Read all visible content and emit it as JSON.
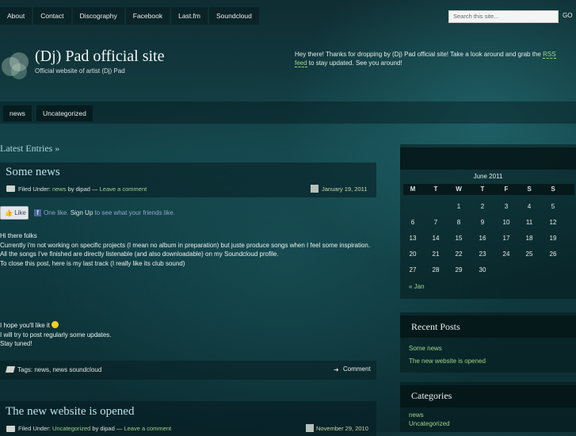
{
  "nav": [
    "About",
    "Contact",
    "Discography",
    "Facebook",
    "Last.fm",
    "Soundcloud"
  ],
  "search": {
    "placeholder": "Search this site...",
    "go_label": "GO"
  },
  "site": {
    "title": "(Dj) Pad official site",
    "tagline": "Official website of artist (Dj) Pad",
    "welcome_before": "Hey there! Thanks for dropping by (Dj) Pad official site! Take a look around and grab the ",
    "welcome_link": "RSS feed",
    "welcome_after": " to stay updated. See you around!"
  },
  "categories_bar": [
    "news",
    "Uncategorized"
  ],
  "latest_label": "Latest Entries »",
  "posts": [
    {
      "title": "Some news",
      "filed_under": "Filed Under:",
      "category": "news",
      "by": "by dipad —",
      "comment_link": "Leave a comment",
      "date": "January 19, 2011"
    },
    {
      "title": "The new website is opened",
      "filed_under": "Filed Under:",
      "category": "Uncategorized",
      "by": "by dipad —",
      "comment_link": "Leave a comment",
      "date": "November 29, 2010"
    }
  ],
  "like": {
    "button": "Like",
    "count": "One like.",
    "signup": "Sign Up",
    "rest": "to see what your friends like."
  },
  "post_body": [
    "Hi there folks",
    "Currently i'm not working on specific projects (I mean no album in preparation) but juste produce songs when  I feel some inspiration.",
    "All the songs I've finished are directly listenable (and also downloadable) on my Soundcloud profile.",
    "To close this post, here is my last track (I really like its club sound)"
  ],
  "post_end": [
    "I hope you'll like it",
    "I will try to post regularly some updates.",
    "Stay tuned!"
  ],
  "post_footer": {
    "tags_label": "Tags:",
    "tags": "news, news soundcloud",
    "comment": "Comment"
  },
  "calendar": {
    "caption": "June 2011",
    "days": [
      "M",
      "T",
      "W",
      "T",
      "F",
      "S",
      "S"
    ],
    "weeks": [
      [
        "",
        "",
        "1",
        "2",
        "3",
        "4",
        "5"
      ],
      [
        "6",
        "7",
        "8",
        "9",
        "10",
        "11",
        "12"
      ],
      [
        "13",
        "14",
        "15",
        "16",
        "17",
        "18",
        "19"
      ],
      [
        "20",
        "21",
        "22",
        "23",
        "24",
        "25",
        "26"
      ],
      [
        "27",
        "28",
        "29",
        "30",
        "",
        "",
        ""
      ]
    ],
    "prev": "« Jan"
  },
  "recent_posts": {
    "title": "Recent Posts",
    "items": [
      "Some news",
      "The new website is opened"
    ]
  },
  "categories_widget": {
    "title": "Categories",
    "items": [
      "news",
      "Uncategorized"
    ]
  },
  "colors": {
    "link": "#9fd38a",
    "title": "#b8e3e6",
    "bg": "#13444a"
  }
}
